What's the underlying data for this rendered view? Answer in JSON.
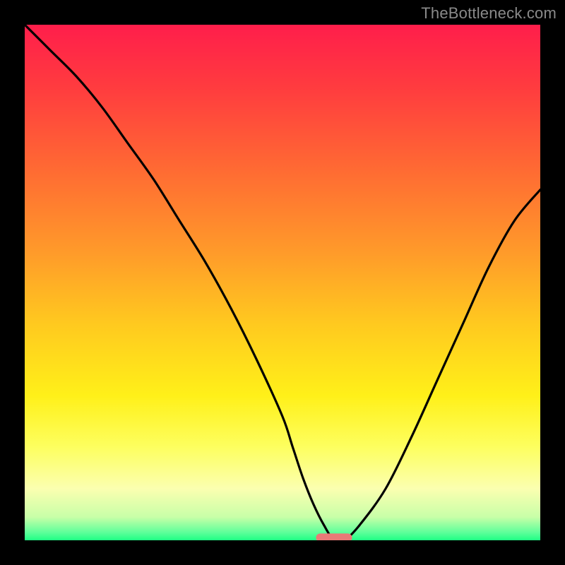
{
  "watermark": "TheBottleneck.com",
  "chart_data": {
    "type": "line",
    "title": "",
    "xlabel": "",
    "ylabel": "",
    "xlim": [
      0,
      100
    ],
    "ylim": [
      0,
      100
    ],
    "grid": false,
    "legend": false,
    "gradient_stops": [
      {
        "pos": 0.0,
        "color": "#ff1e4b"
      },
      {
        "pos": 0.12,
        "color": "#ff3b3f"
      },
      {
        "pos": 0.28,
        "color": "#ff6a33"
      },
      {
        "pos": 0.44,
        "color": "#ff9a2a"
      },
      {
        "pos": 0.58,
        "color": "#ffc91f"
      },
      {
        "pos": 0.72,
        "color": "#fff019"
      },
      {
        "pos": 0.82,
        "color": "#fdff60"
      },
      {
        "pos": 0.9,
        "color": "#fbffb0"
      },
      {
        "pos": 0.955,
        "color": "#c8ffa8"
      },
      {
        "pos": 0.985,
        "color": "#5dff9a"
      },
      {
        "pos": 1.0,
        "color": "#1fff84"
      }
    ],
    "series": [
      {
        "name": "bottleneck-curve",
        "color": "#000000",
        "x": [
          0,
          5,
          10,
          15,
          20,
          25,
          30,
          35,
          40,
          45,
          50,
          52,
          54,
          56,
          58,
          60,
          62,
          65,
          70,
          75,
          80,
          85,
          90,
          95,
          100
        ],
        "y": [
          100,
          95,
          90,
          84,
          77,
          70,
          62,
          54,
          45,
          35,
          24,
          18,
          12,
          7,
          3,
          0,
          0,
          3,
          10,
          20,
          31,
          42,
          53,
          62,
          68
        ]
      }
    ],
    "marker": {
      "name": "optimal-range",
      "color": "#e97a77",
      "x_center": 60,
      "width": 7,
      "y": 0.5
    }
  }
}
